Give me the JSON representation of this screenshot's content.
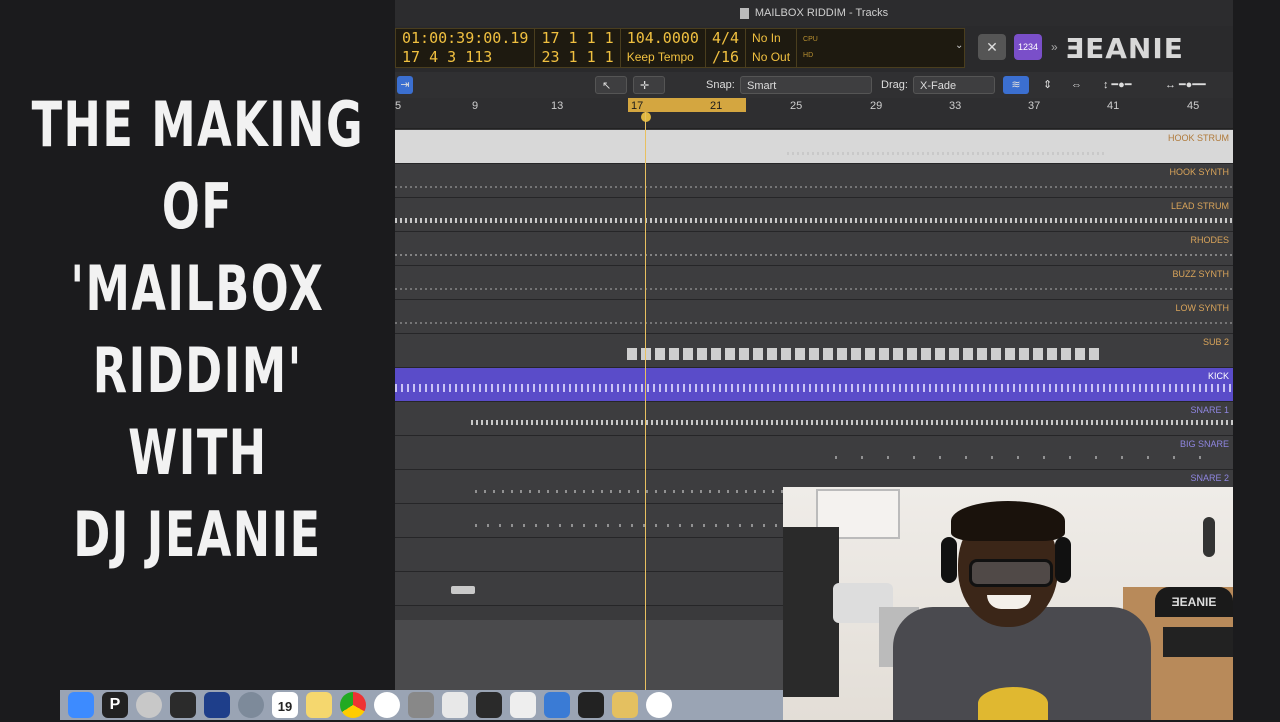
{
  "overlay_title": {
    "lines": [
      "THE MAKING",
      "OF",
      "'MAILBOX",
      "RIDDIM'",
      "WITH",
      "DJ JEANIE"
    ]
  },
  "window": {
    "title": "MAILBOX RIDDIM - Tracks"
  },
  "lcd": {
    "time": "01:00:39:00.19",
    "bars_time": "17 4 3 113",
    "pos_a": "17  1  1   1",
    "pos_b": "23  1  1   1",
    "tempo": "104.0000",
    "tempo_mode": "Keep Tempo",
    "signature": "4/4",
    "division": "/16",
    "in": "No In",
    "out": "No Out",
    "cpu_label": "CPU",
    "hd_label": "HD"
  },
  "top_buttons": {
    "count_in": "1234",
    "close": "✕"
  },
  "logo": "ƎEANIE",
  "toolbar": {
    "snap_label": "Snap:",
    "snap_value": "Smart",
    "drag_label": "Drag:",
    "drag_value": "X-Fade"
  },
  "ruler": {
    "marks": [
      "5",
      "9",
      "13",
      "17",
      "21",
      "25",
      "29",
      "33",
      "37",
      "41",
      "45"
    ]
  },
  "tracks": [
    {
      "name": "HOOK STRUM",
      "color": "#d9a45a"
    },
    {
      "name": "HOOK SYNTH",
      "color": "#d9a45a"
    },
    {
      "name": "LEAD STRUM",
      "color": "#d9a45a"
    },
    {
      "name": "RHODES",
      "color": "#d9a45a"
    },
    {
      "name": "BUZZ SYNTH",
      "color": "#d9a45a"
    },
    {
      "name": "LOW SYNTH",
      "color": "#d9a45a"
    },
    {
      "name": "SUB 2",
      "color": "#d9a45a"
    },
    {
      "name": "KICK",
      "color": "#ffffff"
    },
    {
      "name": "SNARE 1",
      "color": "#8f86e0"
    },
    {
      "name": "BIG SNARE",
      "color": "#8f86e0"
    },
    {
      "name": "SNARE 2",
      "color": "#8f86e0"
    }
  ],
  "dock": {
    "apps": [
      "finder-icon",
      "plex-icon",
      "disk-utility-icon",
      "final-cut-icon",
      "launchpad-icon",
      "rocket-icon",
      "calendar-icon",
      "notes-icon",
      "chrome-icon",
      "music-icon",
      "system-preferences-icon",
      "mail-icon",
      "piano-icon",
      "spreadsheet-icon",
      "logic-icon",
      "ilok-icon",
      "files-icon",
      "safari-icon"
    ],
    "calendar_day": "19"
  },
  "webcam": {
    "cap_logo": "ƎEANIE"
  }
}
